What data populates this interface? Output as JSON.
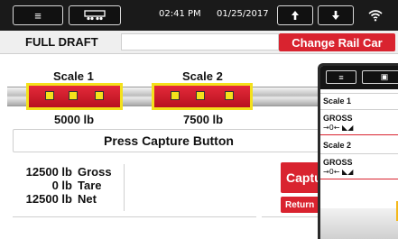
{
  "statusbar": {
    "menu_icon": "menu-icon",
    "device_icon": "railcar-icon",
    "time": "02:41 PM",
    "date": "01/25/2017",
    "up_icon": "arrow-up-icon",
    "down_icon": "arrow-down-icon",
    "wifi_icon": "wifi-icon"
  },
  "header": {
    "title": "FULL DRAFT",
    "rail_car_value": "",
    "change_button": "Change Rail Car"
  },
  "scales": [
    {
      "label": "Scale 1",
      "weight": "5000 lb"
    },
    {
      "label": "Scale 2",
      "weight": "7500 lb"
    }
  ],
  "message": "Press Capture Button",
  "totals": [
    {
      "value": "12500 lb",
      "label": "Gross"
    },
    {
      "value": "0 lb",
      "label": "Tare"
    },
    {
      "value": "12500 lb",
      "label": "Net"
    }
  ],
  "buttons": {
    "capture": "Captu",
    "return": "Return"
  },
  "overlay": {
    "scale1_label": "Scale 1",
    "scale1_mode": "GROSS",
    "scale1_symbols": "→0← ◣◢",
    "scale2_label": "Scale 2",
    "scale2_mode": "GROSS",
    "scale2_symbols": "→0← ◣◢"
  },
  "colors": {
    "accent": "#d9232f",
    "highlight": "#f4e11b",
    "statusbar": "#1a1a1a"
  }
}
